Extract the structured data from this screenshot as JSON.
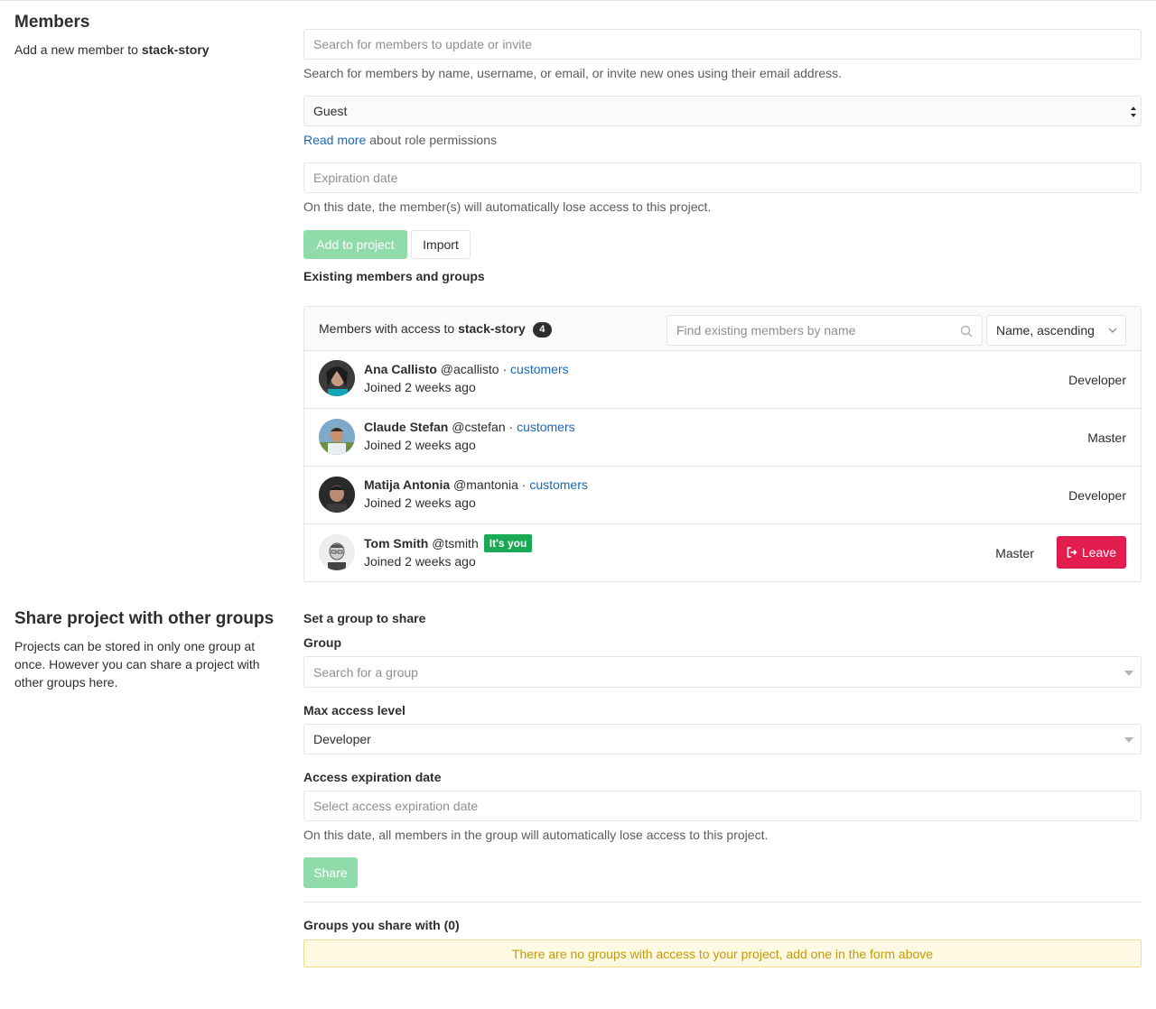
{
  "members_section": {
    "title": "Members",
    "desc_prefix": "Add a new member to ",
    "project": "stack-story"
  },
  "invite": {
    "search_placeholder": "Search for members to update or invite",
    "search_help": "Search for members by name, username, or email, or invite new ones using their email address.",
    "role_selected": "Guest",
    "read_more": "Read more",
    "read_more_suffix": " about role permissions",
    "expiration_placeholder": "Expiration date",
    "expiration_help": "On this date, the member(s) will automatically lose access to this project.",
    "add_button": "Add to project",
    "import_button": "Import"
  },
  "existing": {
    "heading": "Existing members and groups",
    "panel_title_prefix": "Members with access to ",
    "project": "stack-story",
    "count": "4",
    "filter_placeholder": "Find existing members by name",
    "sort_selected": "Name, ascending",
    "members": [
      {
        "name": "Ana Callisto",
        "username": "@acallisto",
        "separator": "·",
        "group": "customers",
        "joined": "Joined 2 weeks ago",
        "role": "Developer"
      },
      {
        "name": "Claude Stefan",
        "username": "@cstefan",
        "separator": "·",
        "group": "customers",
        "joined": "Joined 2 weeks ago",
        "role": "Master"
      },
      {
        "name": "Matija Antonia",
        "username": "@mantonia",
        "separator": "·",
        "group": "customers",
        "joined": "Joined 2 weeks ago",
        "role": "Developer"
      },
      {
        "name": "Tom Smith",
        "username": "@tsmith",
        "badge": "It's you",
        "joined": "Joined 2 weeks ago",
        "role": "Master",
        "leave_button": "Leave"
      }
    ]
  },
  "share_section": {
    "title": "Share project with other groups",
    "desc": "Projects can be stored in only one group at once. However you can share a project with other groups here.",
    "set_group": "Set a group to share",
    "group_label": "Group",
    "group_placeholder": "Search for a group",
    "max_access_label": "Max access level",
    "max_access_selected": "Developer",
    "expiration_label": "Access expiration date",
    "expiration_placeholder": "Select access expiration date",
    "expiration_help": "On this date, all members in the group will automatically lose access to this project.",
    "share_button": "Share",
    "groups_heading": "Groups you share with (0)",
    "empty_alert": "There are no groups with access to your project, add one in the form above"
  },
  "colors": {
    "link": "#1b69b6",
    "success_disabled": "#8fdcaa",
    "danger": "#e41d4f",
    "badge_green": "#1aaa55",
    "alert_bg": "#fdf9e3",
    "alert_text": "#c49b06"
  }
}
